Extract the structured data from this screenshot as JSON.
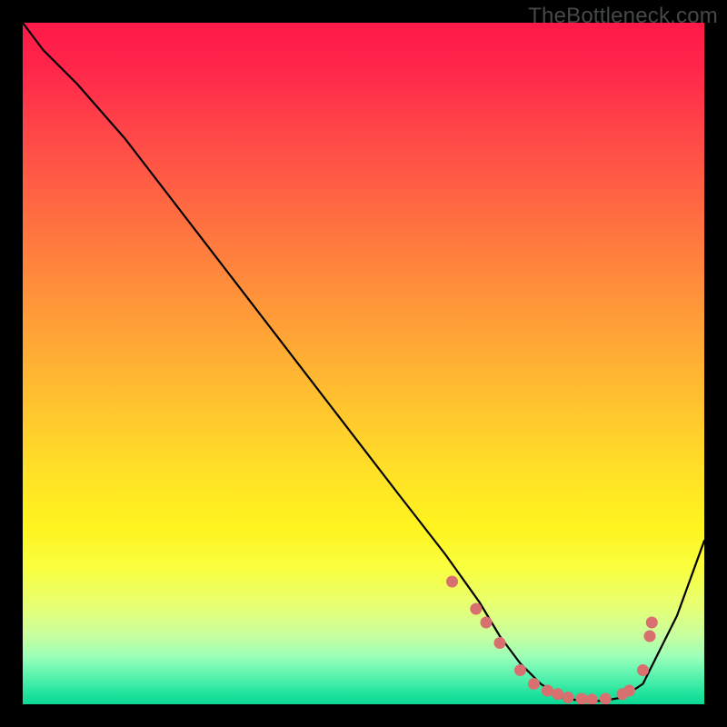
{
  "watermark": "TheBottleneck.com",
  "chart_data": {
    "type": "line",
    "title": "",
    "xlabel": "",
    "ylabel": "",
    "xlim": [
      0,
      100
    ],
    "ylim": [
      0,
      100
    ],
    "series": [
      {
        "name": "curve",
        "x": [
          0,
          3,
          8,
          15,
          25,
          35,
          45,
          55,
          62,
          67,
          70,
          73,
          76,
          79,
          82,
          85,
          88,
          91,
          93,
          96,
          100
        ],
        "y": [
          100,
          96,
          91,
          83,
          70,
          57,
          44,
          31,
          22,
          15,
          10,
          6,
          3,
          1,
          0.5,
          0.5,
          1,
          3,
          7,
          13,
          24
        ]
      }
    ],
    "markers": {
      "name": "dots",
      "x": [
        63,
        66.5,
        68,
        70,
        73,
        75,
        77,
        78.5,
        80,
        82,
        83.5,
        85.5,
        88,
        89,
        91,
        92,
        92.3
      ],
      "y": [
        18,
        14,
        12,
        9,
        5,
        3,
        2,
        1.5,
        1,
        0.8,
        0.7,
        0.8,
        1.5,
        2,
        5,
        10,
        12
      ]
    },
    "gradient_colors": {
      "top": "#ff1a47",
      "mid": "#ffde27",
      "bottom": "#0bd893"
    }
  }
}
